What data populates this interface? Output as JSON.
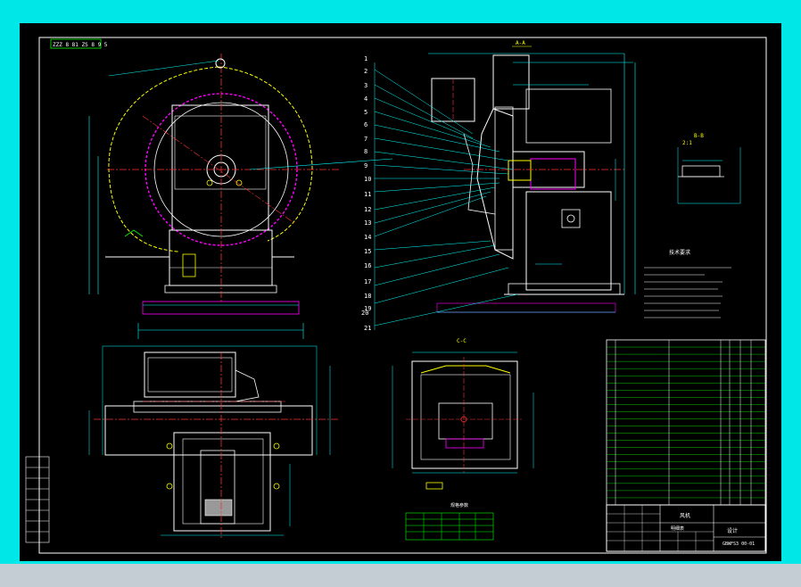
{
  "drawing": {
    "title_stamp": "ZZZ 8 81 ZS 8 9 5",
    "section_aa": "A-A",
    "section_bb": "B-B",
    "section_cc": "C-C",
    "detail_label": "2:1",
    "part_numbers": [
      "1",
      "2",
      "3",
      "4",
      "5",
      "6",
      "7",
      "8",
      "9",
      "10",
      "11",
      "12",
      "13",
      "14",
      "15",
      "16",
      "17",
      "18",
      "19",
      "20",
      "21"
    ],
    "notes_title": "技术要求",
    "parts_table_title": "明细表",
    "title_block": {
      "name": "风机",
      "code": "GBWFS3 00-01",
      "org": "设计"
    },
    "small_table_label": "规格参数"
  },
  "colors": {
    "background": "#000000",
    "border": "#00e7e7",
    "outline": "#ffffff",
    "dimension": "#00ffff",
    "centerline": "#ff3030",
    "hidden": "#ffff00",
    "magenta": "#ff00ff",
    "green": "#00ff00",
    "yellow": "#ffff00"
  }
}
